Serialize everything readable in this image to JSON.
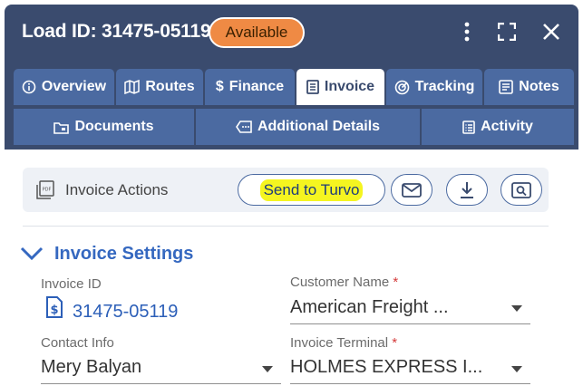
{
  "header": {
    "title": "Load ID: 31475-05119",
    "status": "Available",
    "icons": [
      "more-vert-icon",
      "fullscreen-icon",
      "close-icon"
    ]
  },
  "tabs_row1": [
    {
      "label": "Overview",
      "icon": "info-icon"
    },
    {
      "label": "Routes",
      "icon": "map-icon"
    },
    {
      "label": "Finance",
      "icon": "dollar-icon"
    },
    {
      "label": "Invoice",
      "icon": "document-icon",
      "active": true
    },
    {
      "label": "Tracking",
      "icon": "radar-icon"
    },
    {
      "label": "Notes",
      "icon": "notes-icon"
    }
  ],
  "tabs_row2": [
    {
      "label": "Documents",
      "icon": "folder-icon"
    },
    {
      "label": "Additional Details",
      "icon": "tag-icon"
    },
    {
      "label": "Activity",
      "icon": "list-icon"
    }
  ],
  "actions": {
    "label": "Invoice Actions",
    "send_label": "Send to Turvo",
    "icons": [
      "pdf-icon",
      "email-icon",
      "download-icon",
      "preview-icon"
    ]
  },
  "invoice_settings": {
    "title": "Invoice Settings",
    "invoice_id_label": "Invoice ID",
    "invoice_id_value": "31475-05119",
    "customer_name_label": "Customer Name",
    "customer_name_value": "American Freight ...",
    "contact_info_label": "Contact Info",
    "contact_info_value": "Mery Balyan",
    "invoice_terminal_label": "Invoice Terminal",
    "invoice_terminal_value": "HOLMES EXPRESS I...",
    "required_mark": "*"
  },
  "colors": {
    "header_bg": "#3a4b6e",
    "tab_bg": "#4b6aa1",
    "accent_blue": "#3568c0",
    "status_orange": "#ef8a44",
    "highlight_yellow": "#f5f520"
  }
}
